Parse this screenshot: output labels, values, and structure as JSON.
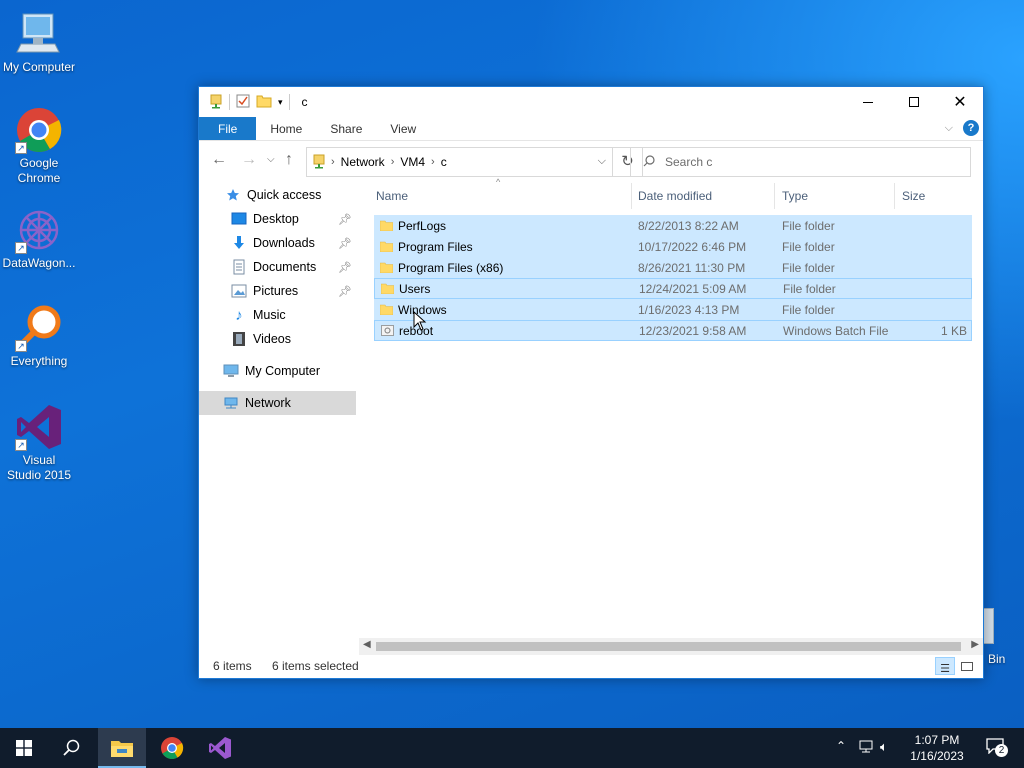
{
  "desktop": {
    "icons": [
      {
        "label": "My Computer"
      },
      {
        "label": "Google Chrome"
      },
      {
        "label": "DataWagon..."
      },
      {
        "label": "Everything"
      },
      {
        "label": "Visual Studio 2015"
      },
      {
        "label": "Bin"
      }
    ]
  },
  "window": {
    "title": "c",
    "ribbon_tabs": [
      "File",
      "Home",
      "Share",
      "View"
    ],
    "help_label": "?",
    "address": {
      "crumbs": [
        "Network",
        "VM4",
        "c"
      ]
    },
    "search": {
      "placeholder": "Search c"
    }
  },
  "navpane": {
    "items": [
      {
        "label": "Quick access",
        "icon": "star-icon"
      },
      {
        "label": "Desktop",
        "icon": "desktop-icon",
        "pinned": true
      },
      {
        "label": "Downloads",
        "icon": "download-icon",
        "pinned": true
      },
      {
        "label": "Documents",
        "icon": "documents-icon",
        "pinned": true
      },
      {
        "label": "Pictures",
        "icon": "pictures-icon",
        "pinned": true
      },
      {
        "label": "Music",
        "icon": "music-icon"
      },
      {
        "label": "Videos",
        "icon": "videos-icon"
      },
      {
        "label": "My Computer",
        "icon": "computer-icon"
      },
      {
        "label": "Network",
        "icon": "network-icon",
        "selected": true
      }
    ]
  },
  "files": {
    "columns": [
      "Name",
      "Date modified",
      "Type",
      "Size"
    ],
    "rows": [
      {
        "name": "PerfLogs",
        "date": "8/22/2013 8:22 AM",
        "type": "File folder",
        "size": "",
        "icon": "folder-icon"
      },
      {
        "name": "Program Files",
        "date": "10/17/2022 6:46 PM",
        "type": "File folder",
        "size": "",
        "icon": "folder-icon"
      },
      {
        "name": "Program Files (x86)",
        "date": "8/26/2021 11:30 PM",
        "type": "File folder",
        "size": "",
        "icon": "folder-icon"
      },
      {
        "name": "Users",
        "date": "12/24/2021 5:09 AM",
        "type": "File folder",
        "size": "",
        "icon": "folder-icon"
      },
      {
        "name": "Windows",
        "date": "1/16/2023 4:13 PM",
        "type": "File folder",
        "size": "",
        "icon": "folder-icon"
      },
      {
        "name": "reboot",
        "date": "12/23/2021 9:58 AM",
        "type": "Windows Batch File",
        "size": "1 KB",
        "icon": "batch-file-icon"
      }
    ]
  },
  "status": {
    "item_count": "6 items",
    "selected_count": "6 items selected"
  },
  "taskbar": {
    "clock_time": "1:07 PM",
    "clock_date": "1/16/2023",
    "notification_count": "2"
  },
  "colors": {
    "accent": "#1979ca",
    "selection": "#cce8ff",
    "taskbar": "#101c2c"
  }
}
